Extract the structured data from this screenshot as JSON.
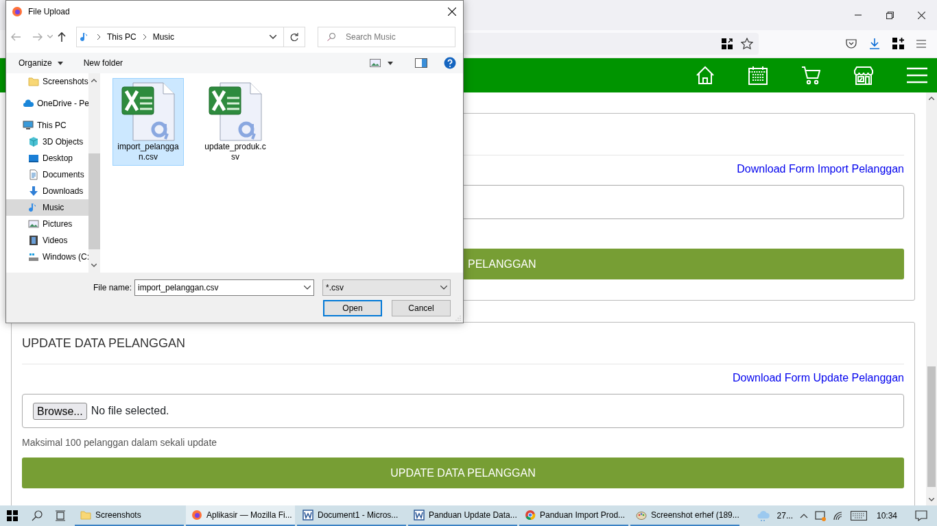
{
  "page": {
    "cards": [
      {
        "download_link": "Download Form Import Pelanggan",
        "submit_button": "PELANGGAN"
      },
      {
        "title": "UPDATE DATA PELANGGAN",
        "download_link": "Download Form Update Pelanggan",
        "file_input": {
          "browse_button": "Browse...",
          "status": "No file selected."
        },
        "hint": "Maksimal 100 pelanggan dalam sekali update",
        "submit_button": "UPDATE DATA PELANGGAN"
      }
    ]
  },
  "dialog": {
    "title": "File Upload",
    "breadcrumb": [
      "This PC",
      "Music"
    ],
    "search": {
      "placeholder": "Search Music"
    },
    "toolbar": {
      "organize": "Organize",
      "new_folder": "New folder"
    },
    "nav_tree": [
      {
        "children": [
          {
            "label": "Screenshots",
            "kind": "folder",
            "selected": false
          }
        ]
      },
      {
        "label": "OneDrive - Pe",
        "kind": "cloud",
        "selected": false
      },
      {
        "label": "This PC",
        "kind": "pc",
        "selected": false,
        "children": [
          {
            "label": "3D Objects",
            "kind": "cube",
            "selected": false
          },
          {
            "label": "Desktop",
            "kind": "desktop",
            "selected": false
          },
          {
            "label": "Documents",
            "kind": "document",
            "selected": false
          },
          {
            "label": "Downloads",
            "kind": "download",
            "selected": false
          },
          {
            "label": "Music",
            "kind": "music",
            "selected": true
          },
          {
            "label": "Pictures",
            "kind": "pictures",
            "selected": false
          },
          {
            "label": "Videos",
            "kind": "video",
            "selected": false
          },
          {
            "label": "Windows (C:",
            "kind": "drive",
            "selected": false
          }
        ]
      }
    ],
    "files": [
      {
        "name": "import_pelanggan.csv",
        "selected": true
      },
      {
        "name": "update_produk.csv",
        "selected": false
      }
    ],
    "file_name_label": "File name:",
    "file_name": "import_pelanggan.csv",
    "file_type": "*.csv",
    "buttons": [
      {
        "label": "Open",
        "default": true
      },
      {
        "label": "Cancel",
        "default": false
      }
    ]
  },
  "taskbar": {
    "apps": [
      {
        "label": "Screenshots",
        "kind": "folder",
        "active": false
      },
      {
        "label": "Aplikasir — Mozilla Fi...",
        "kind": "firefox",
        "active": true
      },
      {
        "label": "Document1 - Micros...",
        "kind": "word",
        "active": false
      },
      {
        "label": "Panduan Update Data...",
        "kind": "word",
        "active": false
      },
      {
        "label": "Panduan Import Prod...",
        "kind": "chrome",
        "active": false
      },
      {
        "label": "Screenshot erhef (189...",
        "kind": "paint",
        "active": false
      }
    ],
    "weather": "27...",
    "clock": "10:34"
  }
}
